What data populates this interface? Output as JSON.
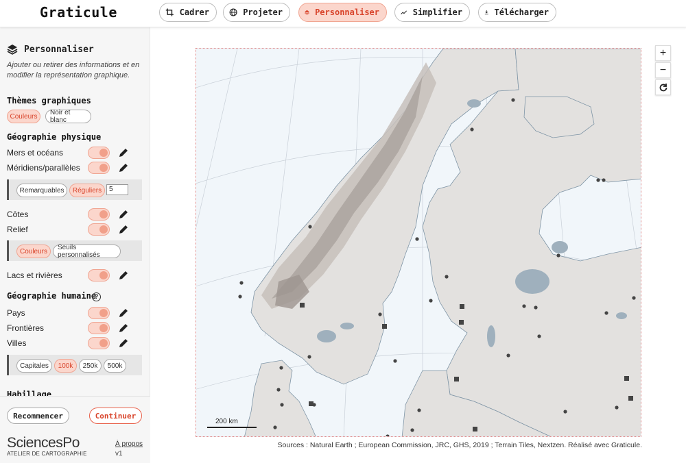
{
  "app": {
    "title": "Graticule"
  },
  "nav": {
    "tabs": [
      {
        "label": "Cadrer",
        "icon": "crop-icon"
      },
      {
        "label": "Projeter",
        "icon": "globe-icon"
      },
      {
        "label": "Personnaliser",
        "icon": "layers-icon",
        "active": true
      },
      {
        "label": "Simplifier",
        "icon": "trend-line-icon"
      },
      {
        "label": "Télécharger",
        "icon": "download-icon"
      }
    ]
  },
  "sidebar": {
    "title": "Personnaliser",
    "description": "Ajouter ou retirer des informations et en modifier la représentation graphique.",
    "themes": {
      "heading": "Thèmes graphiques",
      "options": [
        "Couleurs",
        "Noir et blanc"
      ],
      "selected": "Couleurs"
    },
    "physical": {
      "heading": "Géographie physique",
      "layers": {
        "seas": "Mers et océans",
        "graticule": "Méridiens/parallèles",
        "coasts": "Côtes",
        "relief": "Relief",
        "lakes": "Lacs et rivières"
      },
      "graticule_options": [
        "Remarquables",
        "Réguliers"
      ],
      "graticule_selected": "Réguliers",
      "graticule_step": "5",
      "relief_options": [
        "Couleurs",
        "Seuils personnalisés"
      ],
      "relief_selected": "Couleurs"
    },
    "human": {
      "heading": "Géographie humaine",
      "help": "?",
      "layers": {
        "countries": "Pays",
        "borders": "Frontières",
        "cities": "Villes"
      },
      "city_options": [
        "Capitales",
        "100k",
        "250k",
        "500k"
      ],
      "city_selected": "100k"
    },
    "dressing": {
      "heading": "Habillage"
    },
    "footer": {
      "reset": "Recommencer",
      "continue": "Continuer",
      "logo_main": "SciencesPo",
      "logo_sub": "ATELIER DE CARTOGRAPHIE",
      "about": "À propos",
      "version": "v1"
    }
  },
  "map": {
    "zoom_in": "+",
    "zoom_out": "−",
    "scale": "200 km",
    "sources": "Sources : Natural Earth ; European Commission, JRC, GHS, 2019 ; Terrain Tiles, Nextzen. Réalisé avec Graticule."
  },
  "colors": {
    "accent": "#d8432a",
    "accent_light": "#fbd6cc",
    "land": "#e3e1df",
    "sea": "#f1f6fa",
    "lake": "#9fb0bd"
  }
}
